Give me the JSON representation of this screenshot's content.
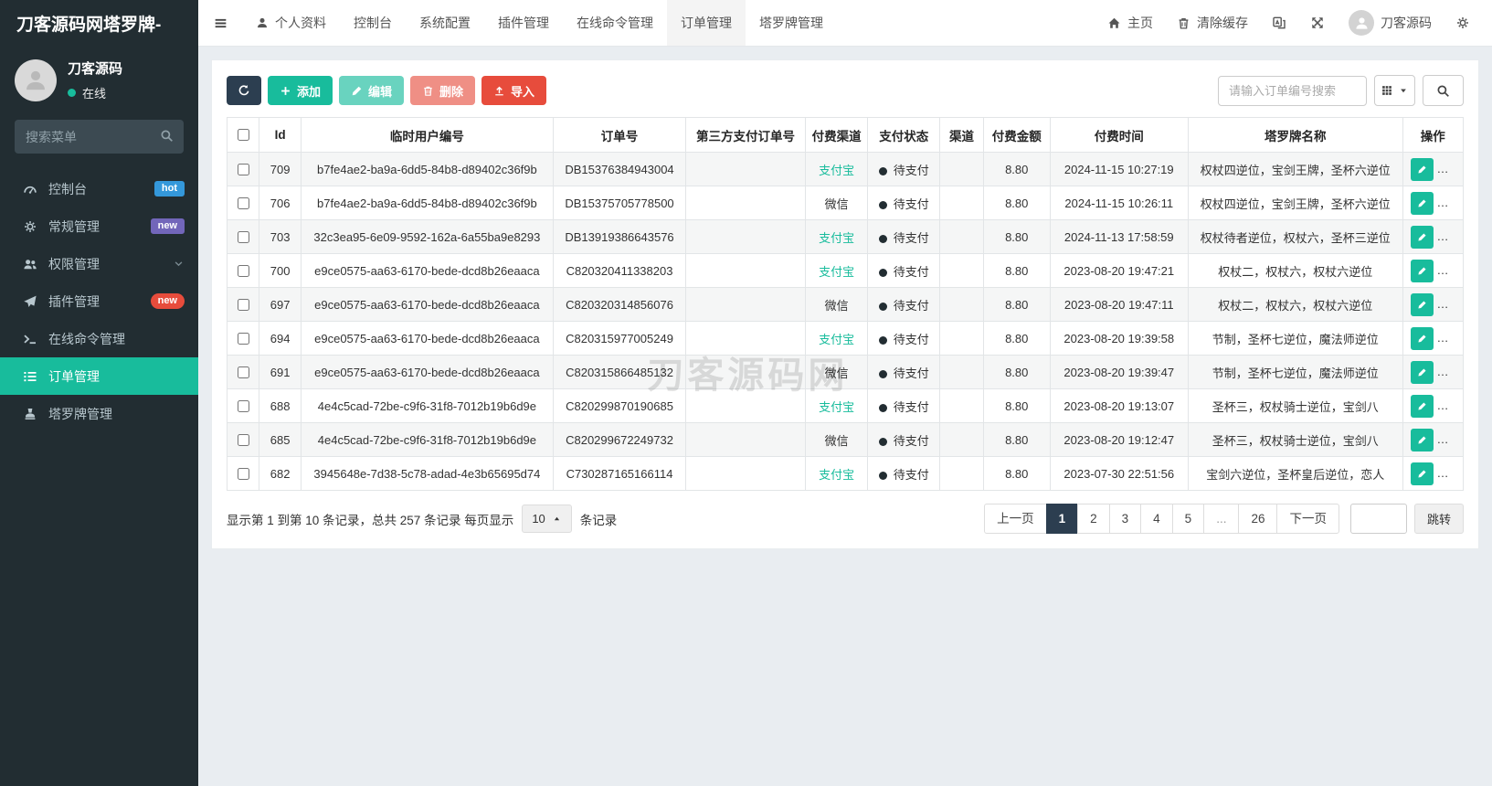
{
  "brand": {
    "logo": "刀客源码网塔罗牌-"
  },
  "topnav": {
    "items": [
      {
        "key": "profile",
        "label": "个人资料",
        "icon": "user"
      },
      {
        "key": "console",
        "label": "控制台"
      },
      {
        "key": "system-config",
        "label": "系统配置"
      },
      {
        "key": "plugin",
        "label": "插件管理"
      },
      {
        "key": "command",
        "label": "在线命令管理"
      },
      {
        "key": "order",
        "label": "订单管理",
        "active": true
      },
      {
        "key": "tarot",
        "label": "塔罗牌管理"
      }
    ],
    "right": {
      "home_label": "主页",
      "clear_cache_label": "清除缓存",
      "username": "刀客源码"
    }
  },
  "sidebar": {
    "user": {
      "name": "刀客源码",
      "status": "在线"
    },
    "search_placeholder": "搜索菜单",
    "items": [
      {
        "key": "console",
        "label": "控制台",
        "icon": "dashboard",
        "badge": "hot",
        "badge_color": "#3498db",
        "badge_shape": "square"
      },
      {
        "key": "general",
        "label": "常规管理",
        "icon": "gears",
        "badge": "new",
        "badge_color": "#7266ba",
        "badge_shape": "square"
      },
      {
        "key": "permission",
        "label": "权限管理",
        "icon": "users",
        "chevron": true
      },
      {
        "key": "plugin",
        "label": "插件管理",
        "icon": "paper-plane",
        "badge": "new",
        "badge_color": "#e74c3c",
        "badge_shape": "pill"
      },
      {
        "key": "command",
        "label": "在线命令管理",
        "icon": "terminal"
      },
      {
        "key": "order",
        "label": "订单管理",
        "icon": "list",
        "active": true
      },
      {
        "key": "tarot",
        "label": "塔罗牌管理",
        "icon": "stamp"
      }
    ]
  },
  "toolbar": {
    "add_label": "添加",
    "edit_label": "编辑",
    "delete_label": "删除",
    "import_label": "导入",
    "search_placeholder": "请输入订单编号搜索"
  },
  "table": {
    "columns": [
      {
        "key": "id",
        "label": "Id"
      },
      {
        "key": "temp-user-code",
        "label": "临时用户编号"
      },
      {
        "key": "order-no",
        "label": "订单号"
      },
      {
        "key": "third-party-no",
        "label": "第三方支付订单号"
      },
      {
        "key": "pay-channel",
        "label": "付费渠道"
      },
      {
        "key": "pay-status",
        "label": "支付状态"
      },
      {
        "key": "channel",
        "label": "渠道"
      },
      {
        "key": "pay-amount",
        "label": "付费金额"
      },
      {
        "key": "pay-time",
        "label": "付费时间"
      },
      {
        "key": "tarot-names",
        "label": "塔罗牌名称"
      },
      {
        "key": "actions",
        "label": "操作"
      }
    ],
    "rows": [
      {
        "id": "709",
        "user_code": "b7fe4ae2-ba9a-6dd5-84b8-d89402c36f9b",
        "order_no": "DB15376384943004",
        "third_no": "",
        "pay_channel": "支付宝",
        "status": "待支付",
        "channel": "",
        "amount": "8.80",
        "time": "2024-11-15 10:27:19",
        "tarot": "权杖四逆位，宝剑王牌，圣杯六逆位"
      },
      {
        "id": "706",
        "user_code": "b7fe4ae2-ba9a-6dd5-84b8-d89402c36f9b",
        "order_no": "DB15375705778500",
        "third_no": "",
        "pay_channel": "微信",
        "status": "待支付",
        "channel": "",
        "amount": "8.80",
        "time": "2024-11-15 10:26:11",
        "tarot": "权杖四逆位，宝剑王牌，圣杯六逆位"
      },
      {
        "id": "703",
        "user_code": "32c3ea95-6e09-9592-162a-6a55ba9e8293",
        "order_no": "DB13919386643576",
        "third_no": "",
        "pay_channel": "支付宝",
        "status": "待支付",
        "channel": "",
        "amount": "8.80",
        "time": "2024-11-13 17:58:59",
        "tarot": "权杖待者逆位，权杖六，圣杯三逆位"
      },
      {
        "id": "700",
        "user_code": "e9ce0575-aa63-6170-bede-dcd8b26eaaca",
        "order_no": "C820320411338203",
        "third_no": "",
        "pay_channel": "支付宝",
        "status": "待支付",
        "channel": "",
        "amount": "8.80",
        "time": "2023-08-20 19:47:21",
        "tarot": "权杖二，权杖六，权杖六逆位"
      },
      {
        "id": "697",
        "user_code": "e9ce0575-aa63-6170-bede-dcd8b26eaaca",
        "order_no": "C820320314856076",
        "third_no": "",
        "pay_channel": "微信",
        "status": "待支付",
        "channel": "",
        "amount": "8.80",
        "time": "2023-08-20 19:47:11",
        "tarot": "权杖二，权杖六，权杖六逆位"
      },
      {
        "id": "694",
        "user_code": "e9ce0575-aa63-6170-bede-dcd8b26eaaca",
        "order_no": "C820315977005249",
        "third_no": "",
        "pay_channel": "支付宝",
        "status": "待支付",
        "channel": "",
        "amount": "8.80",
        "time": "2023-08-20 19:39:58",
        "tarot": "节制，圣杯七逆位，魔法师逆位"
      },
      {
        "id": "691",
        "user_code": "e9ce0575-aa63-6170-bede-dcd8b26eaaca",
        "order_no": "C820315866485132",
        "third_no": "",
        "pay_channel": "微信",
        "status": "待支付",
        "channel": "",
        "amount": "8.80",
        "time": "2023-08-20 19:39:47",
        "tarot": "节制，圣杯七逆位，魔法师逆位"
      },
      {
        "id": "688",
        "user_code": "4e4c5cad-72be-c9f6-31f8-7012b19b6d9e",
        "order_no": "C820299870190685",
        "third_no": "",
        "pay_channel": "支付宝",
        "status": "待支付",
        "channel": "",
        "amount": "8.80",
        "time": "2023-08-20 19:13:07",
        "tarot": "圣杯三，权杖骑士逆位，宝剑八"
      },
      {
        "id": "685",
        "user_code": "4e4c5cad-72be-c9f6-31f8-7012b19b6d9e",
        "order_no": "C820299672249732",
        "third_no": "",
        "pay_channel": "微信",
        "status": "待支付",
        "channel": "",
        "amount": "8.80",
        "time": "2023-08-20 19:12:47",
        "tarot": "圣杯三，权杖骑士逆位，宝剑八"
      },
      {
        "id": "682",
        "user_code": "3945648e-7d38-5c78-adad-4e3b65695d74",
        "order_no": "C730287165166114",
        "third_no": "",
        "pay_channel": "支付宝",
        "status": "待支付",
        "channel": "",
        "amount": "8.80",
        "time": "2023-07-30 22:51:56",
        "tarot": "宝剑六逆位，圣杯皇后逆位，恋人"
      }
    ]
  },
  "watermark": "刀客源码网",
  "pagination": {
    "summary_before": "显示第 1 到第 10 条记录，总共 257 条记录 每页显示",
    "page_size": "10",
    "summary_after": "条记录",
    "prev_label": "上一页",
    "next_label": "下一页",
    "pages": [
      "1",
      "2",
      "3",
      "4",
      "5",
      "...",
      "26"
    ],
    "active_page": "1",
    "jump_label": "跳转"
  },
  "colors": {
    "accent": "#18bc9c",
    "primary_dark": "#2c3e50",
    "danger": "#e74c3c",
    "link": "#18bc9c"
  }
}
